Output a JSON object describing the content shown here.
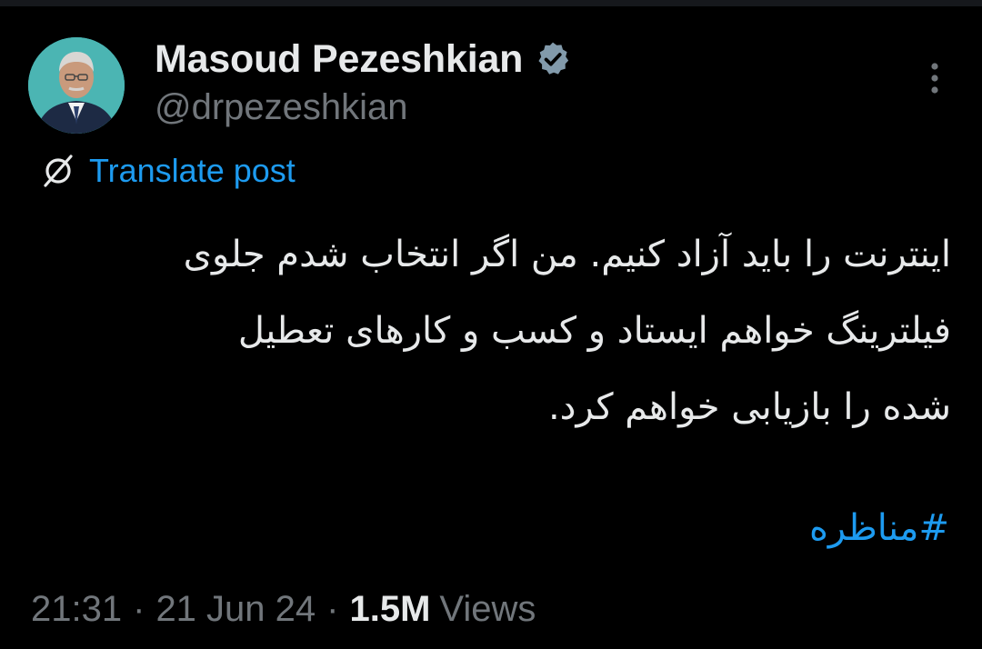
{
  "author": {
    "display_name": "Masoud Pezeshkian",
    "handle": "@drpezeshkian",
    "verified": true,
    "avatar": "portrait-avatar"
  },
  "translate": {
    "icon": "translate-globe-icon",
    "label": "Translate post"
  },
  "tweet": {
    "lines": [
      "اینترنت را باید آزاد کنیم. من اگر انتخاب شدم جلوی",
      "فیلترینگ خواهم ایستاد و کسب و کارهای تعطیل",
      "شده را بازیابی خواهم کرد."
    ],
    "hashtag": "#مناظره"
  },
  "meta": {
    "time": "21:31",
    "separator": "·",
    "date": "21 Jun 24",
    "views_count": "1.5M",
    "views_label": "Views"
  },
  "colors": {
    "background": "#000000",
    "text": "#e7e9ea",
    "secondary": "#71767b",
    "accent": "#1d9bf0"
  },
  "icons": {
    "more": "more-vertical-icon",
    "verified": "verified-badge-icon"
  }
}
